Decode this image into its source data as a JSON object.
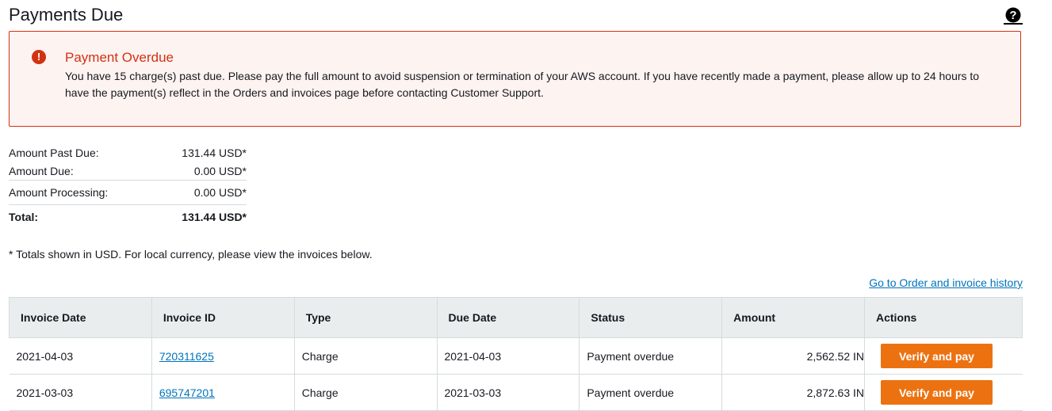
{
  "page": {
    "title": "Payments Due",
    "help_icon": "question-circle-icon"
  },
  "alert": {
    "icon": "exclamation-circle-icon",
    "icon_glyph": "!",
    "title": "Payment Overdue",
    "message": "You have 15 charge(s) past due. Please pay the full amount to avoid suspension or termination of your AWS account. If you have recently made a payment, please allow up to 24 hours to have the payment(s) reflect in the Orders and invoices page before contacting Customer Support."
  },
  "summary": {
    "past_due_label": "Amount Past Due:",
    "past_due_value": "131.44 USD*",
    "due_label": "Amount Due:",
    "due_value": "0.00 USD*",
    "processing_label": "Amount Processing:",
    "processing_value": "0.00 USD*",
    "total_label": "Total:",
    "total_value": "131.44 USD*"
  },
  "note": "* Totals shown in USD. For local currency, please view the invoices below.",
  "history_link": "Go to Order and invoice history",
  "table": {
    "headers": [
      "Invoice Date",
      "Invoice ID",
      "Type",
      "Due Date",
      "Status",
      "Amount",
      "Actions"
    ],
    "rows": [
      {
        "invoice_date": "2021-04-03",
        "invoice_id": "720311625",
        "type": "Charge",
        "due_date": "2021-04-03",
        "status": "Payment overdue",
        "amount": "2,562.52 IN",
        "action": "Verify and pay"
      },
      {
        "invoice_date": "2021-03-03",
        "invoice_id": "695747201",
        "type": "Charge",
        "due_date": "2021-03-03",
        "status": "Payment overdue",
        "amount": "2,872.63 IN",
        "action": "Verify and pay"
      }
    ]
  },
  "colors": {
    "error": "#d13212",
    "button": "#ec7211",
    "link": "#0073bb"
  }
}
